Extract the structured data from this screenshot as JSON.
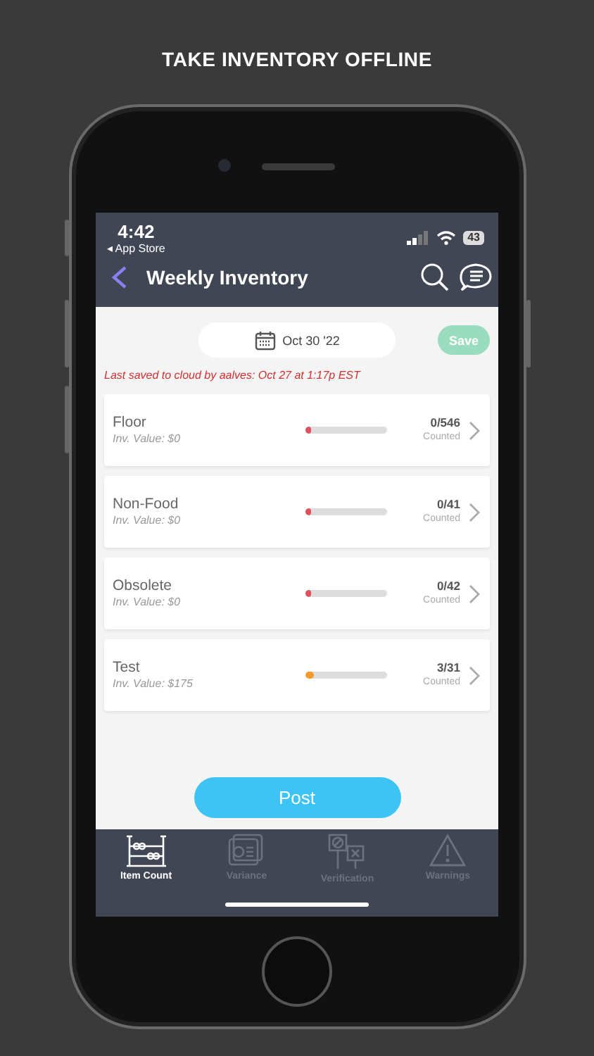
{
  "banner": "TAKE INVENTORY OFFLINE",
  "status_bar": {
    "time": "4:42",
    "back_app": "◂ App Store",
    "battery": "43"
  },
  "nav": {
    "title": "Weekly Inventory"
  },
  "date_picker": {
    "value": "Oct 30 '22"
  },
  "save_button": {
    "label": "Save",
    "disabled": true
  },
  "save_notice": "Last saved to cloud by aalves: Oct 27 at 1:17p EST",
  "locations": [
    {
      "name": "Floor",
      "value": "Inv. Value: $0",
      "level": 0,
      "color": "#e0505a",
      "count": "0/546",
      "count_label": "Counted"
    },
    {
      "name": "Non-Food",
      "value": "Inv. Value: $0",
      "level": 0,
      "color": "#e0505a",
      "count": "0/41",
      "count_label": "Counted"
    },
    {
      "name": "Obsolete",
      "value": "Inv. Value: $0",
      "level": 0,
      "color": "#e0505a",
      "count": "0/42",
      "count_label": "Counted"
    },
    {
      "name": "Test",
      "value": "Inv. Value: $175",
      "level": 0.1,
      "color": "#f39a2b",
      "count": "3/31",
      "count_label": "Counted"
    }
  ],
  "post_button": {
    "label": "Post"
  },
  "tabs": [
    {
      "kind": "abacus",
      "label": "Item Count",
      "selected": true
    },
    {
      "kind": "variance",
      "label": "Variance",
      "selected": false
    },
    {
      "kind": "verification",
      "label": "Verification",
      "selected": false
    },
    {
      "kind": "warning",
      "label": "Warnings",
      "selected": false
    }
  ]
}
